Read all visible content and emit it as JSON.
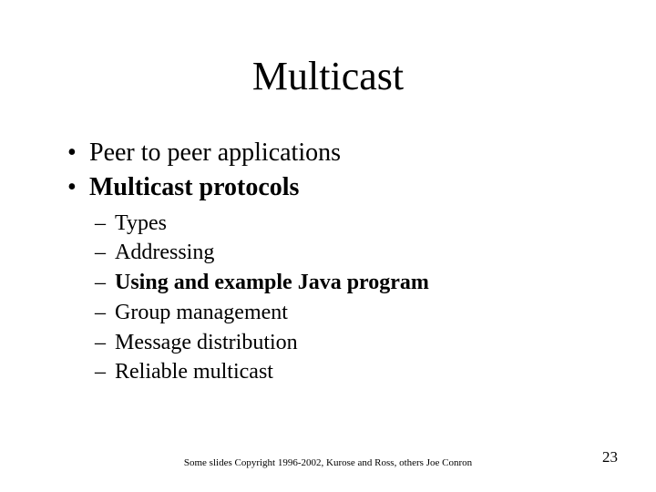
{
  "title": "Multicast",
  "bullets": {
    "b1": "Peer to peer applications",
    "b2": "Multicast protocols",
    "sub": {
      "s1": "Types",
      "s2": "Addressing",
      "s3": "Using and example Java program",
      "s4": "Group management",
      "s5": "Message distribution",
      "s6": "Reliable multicast"
    }
  },
  "footer": "Some slides Copyright 1996-2002, Kurose and Ross, others Joe Conron",
  "page_number": "23"
}
